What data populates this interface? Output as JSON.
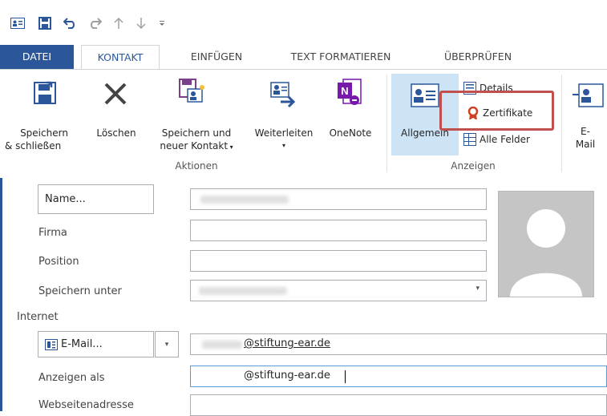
{
  "ribbon_tabs": [
    {
      "label": "DATEI"
    },
    {
      "label": "KONTAKT"
    },
    {
      "label": "EINFÜGEN"
    },
    {
      "label": "TEXT FORMATIEREN"
    },
    {
      "label": "ÜBERPRÜFEN"
    }
  ],
  "actions_group": {
    "label": "Aktionen",
    "save_close": {
      "line1": "Speichern",
      "line2": "& schließen"
    },
    "delete": {
      "line1": "Löschen"
    },
    "save_new": {
      "line1": "Speichern und",
      "line2": "neuer Kontakt"
    },
    "forward": {
      "line1": "Weiterleiten"
    },
    "onenote": {
      "line1": "OneNote"
    }
  },
  "show_group": {
    "label": "Anzeigen",
    "general": "Allgemein",
    "details": "Details",
    "certificates": "Zertifikate",
    "all_fields": "Alle Felder"
  },
  "email_btn": {
    "line1": "E-",
    "line2": "Mail"
  },
  "form": {
    "name_button": "Name...",
    "company_label": "Firma",
    "position_label": "Position",
    "save_as_label": "Speichern unter",
    "internet_label": "Internet",
    "email_button": "E-Mail...",
    "email_value": "@stiftung-ear.de",
    "display_as_label": "Anzeigen als",
    "display_as_value": "@stiftung-ear.de",
    "website_label": "Webseitenadresse"
  },
  "colors": {
    "accent": "#2b579a",
    "highlight": "#c0504d"
  }
}
